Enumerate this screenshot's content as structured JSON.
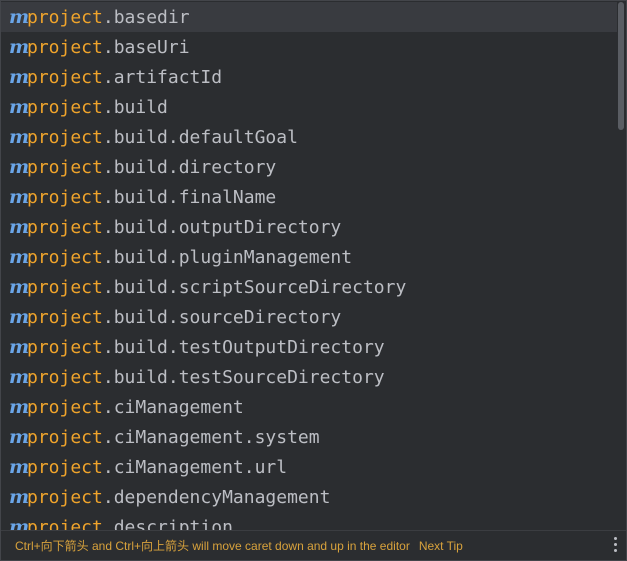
{
  "completion_list": {
    "icon_letter": "m",
    "items": [
      {
        "prefix": "project",
        "rest": ".basedir"
      },
      {
        "prefix": "project",
        "rest": ".baseUri"
      },
      {
        "prefix": "project",
        "rest": ".artifactId"
      },
      {
        "prefix": "project",
        "rest": ".build"
      },
      {
        "prefix": "project",
        "rest": ".build.defaultGoal"
      },
      {
        "prefix": "project",
        "rest": ".build.directory"
      },
      {
        "prefix": "project",
        "rest": ".build.finalName"
      },
      {
        "prefix": "project",
        "rest": ".build.outputDirectory"
      },
      {
        "prefix": "project",
        "rest": ".build.pluginManagement"
      },
      {
        "prefix": "project",
        "rest": ".build.scriptSourceDirectory"
      },
      {
        "prefix": "project",
        "rest": ".build.sourceDirectory"
      },
      {
        "prefix": "project",
        "rest": ".build.testOutputDirectory"
      },
      {
        "prefix": "project",
        "rest": ".build.testSourceDirectory"
      },
      {
        "prefix": "project",
        "rest": ".ciManagement"
      },
      {
        "prefix": "project",
        "rest": ".ciManagement.system"
      },
      {
        "prefix": "project",
        "rest": ".ciManagement.url"
      },
      {
        "prefix": "project",
        "rest": ".dependencyManagement"
      },
      {
        "prefix": "project",
        "rest": ".description"
      }
    ],
    "selected_index": 0
  },
  "footer": {
    "tip": "Ctrl+向下箭头 and Ctrl+向上箭头 will move caret down and up in the editor",
    "next_tip": "Next Tip"
  },
  "colors": {
    "background": "#2b2d30",
    "selected_row": "#393b40",
    "icon": "#6aa5e8",
    "match_prefix": "#f0a42b",
    "text": "#bcbec4",
    "footer_text": "#d8a23c"
  }
}
